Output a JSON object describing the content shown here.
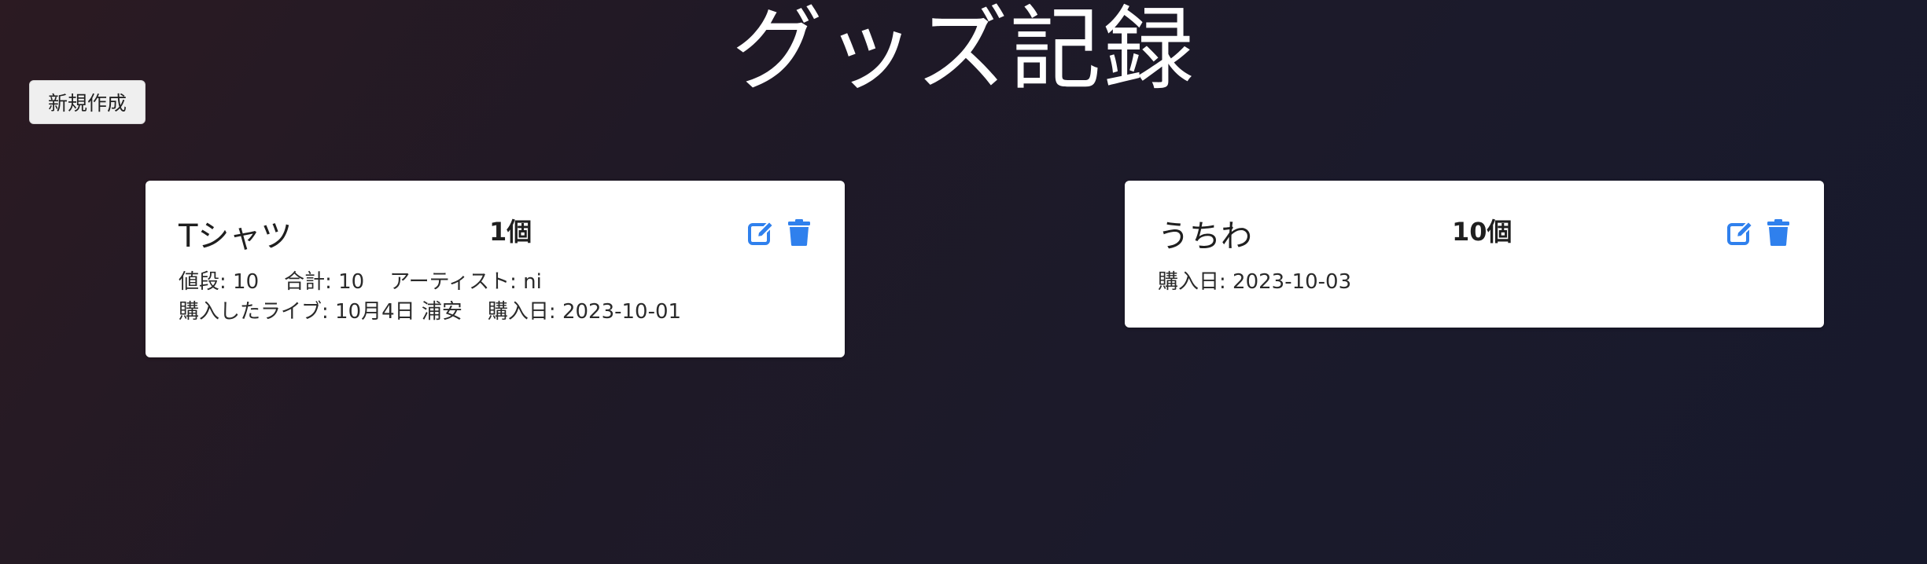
{
  "header": {
    "title": "グッズ記録"
  },
  "toolbar": {
    "new_label": "新規作成"
  },
  "colors": {
    "accent": "#2f80ed",
    "card_bg": "#ffffff"
  },
  "icons": {
    "edit": "edit-icon",
    "delete": "trash-icon"
  },
  "items": [
    {
      "name": "Tシャツ",
      "quantity": "1個",
      "price": "値段: 10",
      "total": "合計: 10",
      "artist": "アーティスト: ni",
      "live": "購入したライブ: 10月4日 浦安",
      "date": "購入日: 2023-10-01"
    },
    {
      "name": "うちわ",
      "quantity": "10個",
      "date": "購入日: 2023-10-03"
    }
  ]
}
